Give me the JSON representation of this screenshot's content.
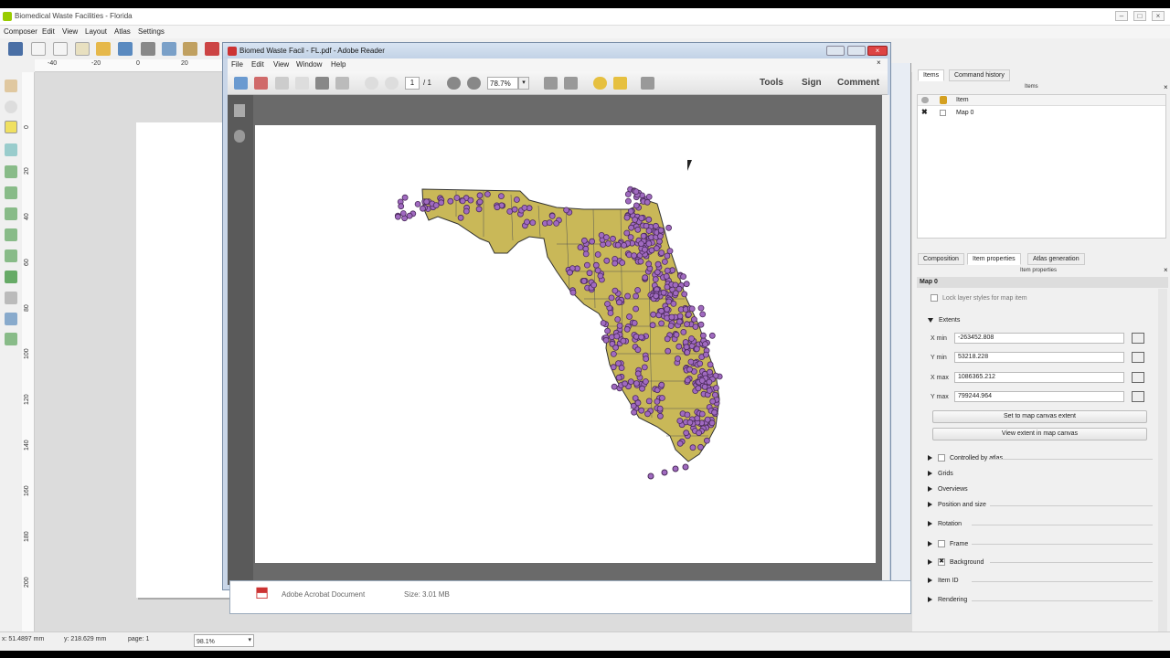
{
  "window": {
    "title": "Biomedical Waste Facilities - Florida"
  },
  "menu": [
    "Composer",
    "Edit",
    "View",
    "Layout",
    "Atlas",
    "Settings"
  ],
  "ruler_top": [
    "-40",
    "-20",
    "0",
    "20"
  ],
  "ruler_left": [
    "0",
    "20",
    "40",
    "60",
    "80",
    "100",
    "120",
    "140",
    "160",
    "180",
    "200"
  ],
  "status": {
    "x": "x: 51.4897 mm",
    "y": "y: 218.629 mm",
    "page": "page: 1",
    "zoom": "98.1%"
  },
  "right_panel": {
    "top_tabs": [
      "Items",
      "Command history"
    ],
    "items_header": "Items",
    "items_col": "Item",
    "items": [
      {
        "name": "Map 0",
        "visible": true,
        "locked": false
      }
    ],
    "bottom_tabs": [
      "Composition",
      "Item properties",
      "Atlas generation"
    ],
    "ip_header": "Item properties",
    "map_title": "Map 0",
    "lock_label": "Lock layer styles for map item",
    "extents_label": "Extents",
    "fields": [
      {
        "label": "X min",
        "value": "-263452.808"
      },
      {
        "label": "Y min",
        "value": "53218.228"
      },
      {
        "label": "X max",
        "value": "1086365.212"
      },
      {
        "label": "Y max",
        "value": "799244.964"
      }
    ],
    "btn_set": "Set to map canvas extent",
    "btn_view": "View extent in map canvas",
    "sections": {
      "atlas": "Controlled by atlas",
      "grids": "Grids",
      "overviews": "Overviews",
      "position": "Position and size",
      "rotation": "Rotation",
      "frame": "Frame",
      "background": "Background",
      "itemid": "Item ID",
      "rendering": "Rendering"
    }
  },
  "adobe": {
    "title": "Biomed Waste Facil - FL.pdf - Adobe Reader",
    "menu": [
      "File",
      "Edit",
      "View",
      "Window",
      "Help"
    ],
    "page_current": "1",
    "page_total": "/ 1",
    "zoom": "78.7%",
    "tools": "Tools",
    "sign": "Sign",
    "comment": "Comment",
    "doc_type": "Adobe Acrobat Document",
    "doc_size": "Size: 3.01 MB"
  },
  "colors": {
    "land": "#c9b858",
    "point": "#a06ac0",
    "point_stroke": "#4a2a5a"
  }
}
